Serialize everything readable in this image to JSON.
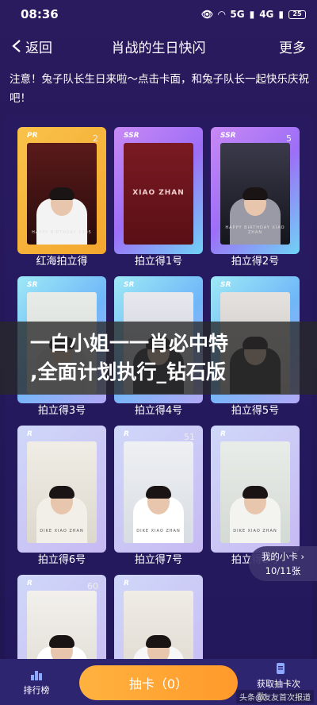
{
  "status_bar": {
    "time": "08:36",
    "battery": "25",
    "signal_5g": "5G",
    "signal_4g": "4G"
  },
  "nav": {
    "back_label": "返回",
    "title": "肖战的生日快闪",
    "more_label": "更多"
  },
  "notice": "注意！兔子队长生日来啦～点击卡面，和兔子队长一起快乐庆祝吧！",
  "cards": [
    {
      "label": "红海拍立得",
      "rarity": "PR",
      "number": "2",
      "caption": "HAPPY BIRTHDAY 1005"
    },
    {
      "label": "拍立得1号",
      "rarity": "SSR",
      "number": "",
      "caption": "XIAO ZHAN"
    },
    {
      "label": "拍立得2号",
      "rarity": "SSR",
      "number": "5",
      "caption": "HAPPY BIRTHDAY XIAO ZHAN"
    },
    {
      "label": "拍立得3号",
      "rarity": "SR",
      "number": "",
      "caption": ""
    },
    {
      "label": "拍立得4号",
      "rarity": "SR",
      "number": "",
      "caption": ""
    },
    {
      "label": "拍立得5号",
      "rarity": "SR",
      "number": "",
      "caption": ""
    },
    {
      "label": "拍立得6号",
      "rarity": "R",
      "number": "",
      "caption": "DIKE XIAO ZHAN"
    },
    {
      "label": "拍立得7号",
      "rarity": "R",
      "number": "51",
      "caption": "DIKE XIAO ZHAN"
    },
    {
      "label": "拍立得8号",
      "rarity": "R",
      "number": "",
      "caption": "DIKE XIAO ZHAN"
    },
    {
      "label": "",
      "rarity": "R",
      "number": "60",
      "caption": ""
    },
    {
      "label": "",
      "rarity": "R",
      "number": "",
      "caption": ""
    }
  ],
  "overlay": {
    "line1": "一白小姐一一肖必中特",
    "line2": ",全面计划执行_钻石版"
  },
  "my_cards": {
    "title": "我的小卡 ›",
    "count": "10/11张"
  },
  "bottom": {
    "ranking_label": "排行榜",
    "draw_label": "抽卡（0）",
    "task_label": "获取抽卡次数"
  },
  "watermark": "头条@友友首次报道",
  "colors": {
    "background": "#24185a",
    "accent_orange": "#ff9a2b",
    "ssr": "#a66ef6",
    "sr": "#6fb7f8",
    "pr": "#f4a62d"
  }
}
